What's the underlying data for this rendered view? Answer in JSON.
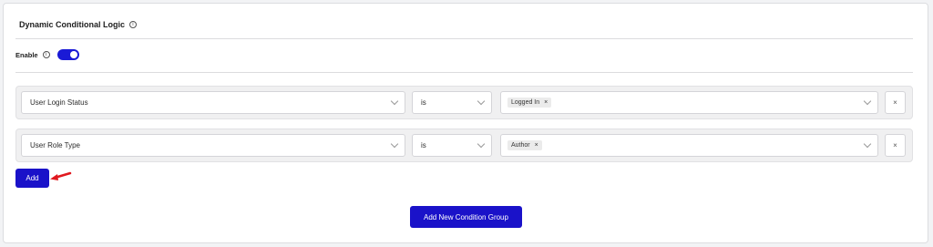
{
  "header": {
    "title": "Dynamic Conditional Logic",
    "info_icon": "info-icon"
  },
  "enable": {
    "label": "Enable",
    "info_icon": "info-icon",
    "toggle_on": true
  },
  "groups": [
    {
      "field": "User Login Status",
      "operator": "is",
      "values": [
        "Logged In"
      ],
      "remove_tag": "×",
      "remove_row": "×"
    },
    {
      "field": "User Role Type",
      "operator": "is",
      "values": [
        "Author"
      ],
      "remove_tag": "×",
      "remove_row": "×"
    }
  ],
  "buttons": {
    "add": "Add",
    "add_group": "Add New Condition Group"
  },
  "colors": {
    "accent": "#1a12c9",
    "toggle": "#1a1ad6",
    "annotation_arrow": "#e0191f"
  }
}
